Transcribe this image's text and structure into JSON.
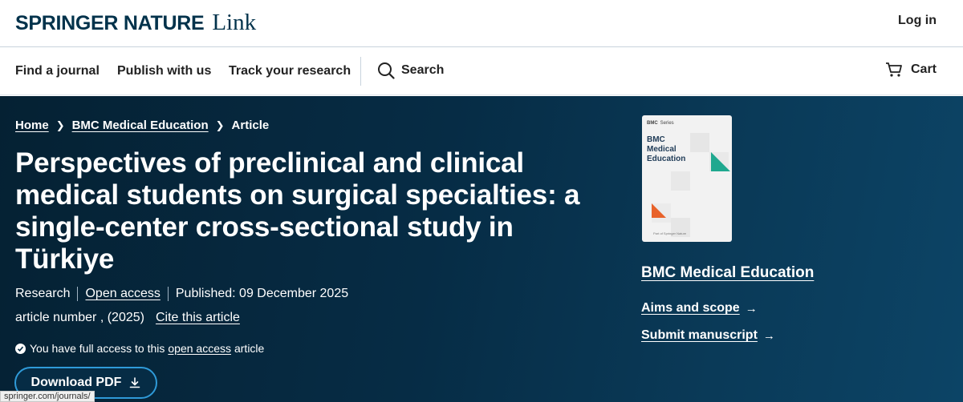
{
  "header": {
    "logo_brand": "SPRINGER NATURE",
    "logo_link": "Link",
    "login": "Log in"
  },
  "nav": {
    "items": [
      "Find a journal",
      "Publish with us",
      "Track your research"
    ],
    "search": "Search",
    "cart": "Cart"
  },
  "breadcrumb": {
    "home": "Home",
    "journal": "BMC Medical Education",
    "current": "Article"
  },
  "article": {
    "title": "Perspectives of preclinical and clinical medical students on surgical specialties: a single-center cross-sectional study in Türkiye",
    "type": "Research",
    "access": "Open access",
    "published": "Published: 09 December 2025",
    "article_number": "article number , (2025)",
    "cite": "Cite this article",
    "full_access_prefix": "You have full access to this",
    "full_access_link": "open access",
    "full_access_suffix": "article",
    "download": "Download PDF"
  },
  "cover": {
    "series": "Series",
    "series_brand": "BMC",
    "title_lines": [
      "BMC",
      "Medical",
      "Education"
    ],
    "publisher": "Part of Springer Nature",
    "colors": {
      "teal": "#1fa88f",
      "orange": "#e8622a"
    }
  },
  "sidebar": {
    "journal_title": "BMC Medical Education",
    "aims": "Aims and scope",
    "submit": "Submit manuscript"
  },
  "status_url": "springer.com/journals/"
}
